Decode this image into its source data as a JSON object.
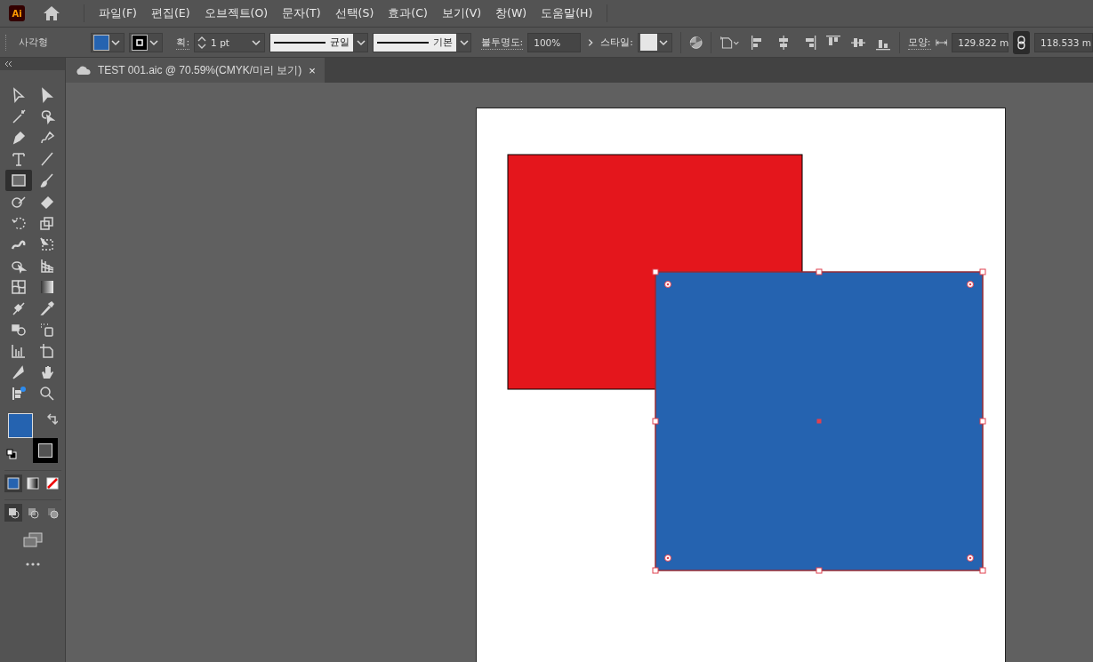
{
  "menu": {
    "app_icon": "Ai",
    "items": [
      "파일(F)",
      "편집(E)",
      "오브젝트(O)",
      "문자(T)",
      "선택(S)",
      "효과(C)",
      "보기(V)",
      "창(W)",
      "도움말(H)"
    ]
  },
  "control_bar": {
    "object_type": "사각형",
    "fill": {
      "color": "#2563b0"
    },
    "stroke": {
      "color": "#000000"
    },
    "stroke_label": "획:",
    "stroke_weight": "1 pt",
    "profile": "균일",
    "brush": "기본",
    "opacity_label": "불투명도:",
    "opacity": "100%",
    "style_label": "스타일:",
    "shape_label": "모양:",
    "width": "129.822 m",
    "height": "118.533 m"
  },
  "document_tab": {
    "title": "TEST 001.aic @ 70.59%(CMYK/미리 보기)",
    "close": "×"
  },
  "tools": [
    {
      "kind": "selection",
      "selected": false
    },
    {
      "kind": "direct",
      "selected": false
    },
    {
      "kind": "wand",
      "selected": false
    },
    {
      "kind": "lasso",
      "selected": false
    },
    {
      "kind": "pen",
      "selected": false
    },
    {
      "kind": "curvature",
      "selected": false
    },
    {
      "kind": "type",
      "selected": false
    },
    {
      "kind": "line",
      "selected": false
    },
    {
      "kind": "rectangle",
      "selected": true
    },
    {
      "kind": "brush",
      "selected": false
    },
    {
      "kind": "shaper",
      "selected": false
    },
    {
      "kind": "eraser",
      "selected": false
    },
    {
      "kind": "rotate",
      "selected": false
    },
    {
      "kind": "scale",
      "selected": false
    },
    {
      "kind": "warp",
      "selected": false
    },
    {
      "kind": "transform",
      "selected": false
    },
    {
      "kind": "builder",
      "selected": false
    },
    {
      "kind": "perspective",
      "selected": false
    },
    {
      "kind": "mesh",
      "selected": false
    },
    {
      "kind": "gradient",
      "selected": false
    },
    {
      "kind": "blend",
      "selected": false
    },
    {
      "kind": "eyedropper",
      "selected": false
    },
    {
      "kind": "shapes",
      "selected": false
    },
    {
      "kind": "spray",
      "selected": false
    },
    {
      "kind": "graph",
      "selected": false
    },
    {
      "kind": "artboard",
      "selected": false
    },
    {
      "kind": "knife",
      "selected": false
    },
    {
      "kind": "hand",
      "selected": false
    },
    {
      "kind": "flags",
      "selected": false
    },
    {
      "kind": "zoom",
      "selected": false
    }
  ],
  "fill_stroke": {
    "fill": {
      "color": "#2563b0"
    },
    "stroke": {
      "color": "#000000"
    }
  },
  "color_modes": [
    {
      "kind": "color",
      "selected": true
    },
    {
      "kind": "gradient",
      "selected": false
    },
    {
      "kind": "none",
      "selected": false
    }
  ],
  "draw_modes": [
    {
      "kind": "normal",
      "selected": true
    },
    {
      "kind": "behind",
      "selected": false
    },
    {
      "kind": "inside",
      "selected": false
    }
  ],
  "artwork": [
    {
      "kind": "rect",
      "color": "#e4161c",
      "selected": false
    },
    {
      "kind": "rect",
      "color": "#2563b0",
      "selected": true
    }
  ]
}
